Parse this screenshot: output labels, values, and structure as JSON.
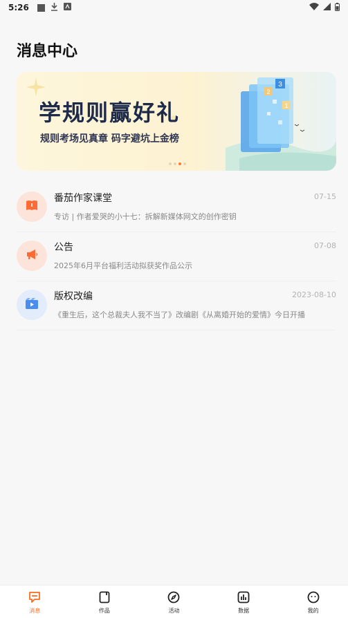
{
  "status_bar": {
    "time": "5:26"
  },
  "page": {
    "title": "消息中心"
  },
  "banner": {
    "title": "学规则赢好礼",
    "subtitle": "规则考场见真章  码字避坑上金榜",
    "page_count": 4,
    "active_index": 2,
    "art_numbers": [
      "3",
      "2",
      "1"
    ]
  },
  "messages": [
    {
      "title": "番茄作家课堂",
      "date": "07-15",
      "preview": "专访 | 作者爱哭的小十七：拆解新媒体网文的创作密钥",
      "icon": "book-icon",
      "color": "#ff6b35"
    },
    {
      "title": "公告",
      "date": "07-08",
      "preview": "2025年6月平台福利活动拟获奖作品公示",
      "icon": "megaphone-icon",
      "color": "#ff6b35"
    },
    {
      "title": "版权改编",
      "date": "2023-08-10",
      "preview": "《重生后，这个总裁夫人我不当了》改编剧《从离婚开始的爱情》今日开播",
      "icon": "video-icon",
      "color": "#4a8df0"
    }
  ],
  "bottom_nav": [
    {
      "label": "消息",
      "icon": "message-icon",
      "active": true
    },
    {
      "label": "作品",
      "icon": "works-icon",
      "active": false
    },
    {
      "label": "活动",
      "icon": "compass-icon",
      "active": false
    },
    {
      "label": "数据",
      "icon": "chart-icon",
      "active": false
    },
    {
      "label": "我的",
      "icon": "profile-icon",
      "active": false
    }
  ],
  "colors": {
    "accent": "#ff6b1f",
    "background": "#f7f7f7"
  }
}
